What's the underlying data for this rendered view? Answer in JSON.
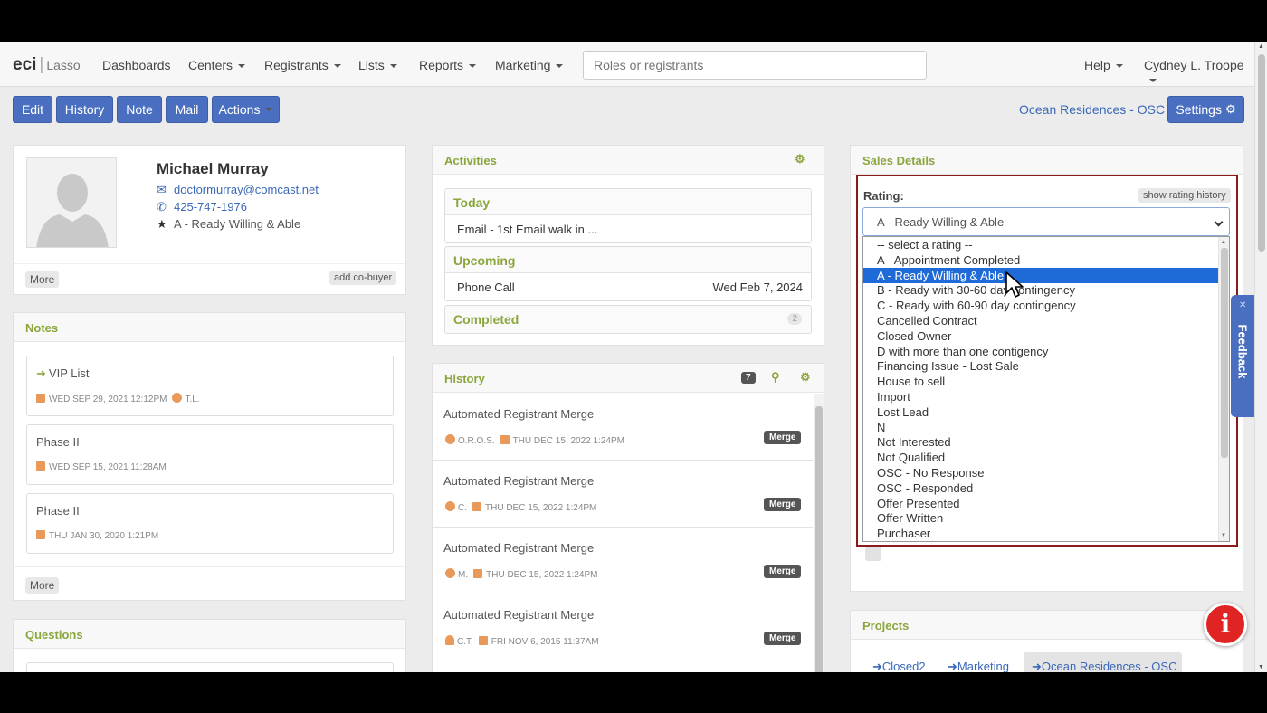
{
  "nav": {
    "logo_main": "eci",
    "logo_sub": "Lasso",
    "items": [
      "Dashboards",
      "Centers",
      "Registrants",
      "Lists",
      "Reports",
      "Marketing"
    ],
    "search_placeholder": "Roles or registrants",
    "help": "Help",
    "user": "Cydney L. Troope"
  },
  "toolbar": {
    "edit": "Edit",
    "history": "History",
    "note": "Note",
    "mail": "Mail",
    "actions": "Actions",
    "center": "Ocean Residences - OSC",
    "settings": "Settings"
  },
  "profile": {
    "name": "Michael Murray",
    "email": "doctormurray@comcast.net",
    "phone": "425-747-1976",
    "rating": "A - Ready Willing & Able",
    "more": "More",
    "add_cobuyer": "add co-buyer"
  },
  "notes": {
    "title": "Notes",
    "items": [
      {
        "title": "VIP List",
        "date": "WED SEP 29, 2021 12:12PM",
        "user": "T.L."
      },
      {
        "title": "Phase II",
        "date": "WED SEP 15, 2021 11:28AM"
      },
      {
        "title": "Phase II",
        "date": "THU JAN 30, 2020 1:21PM"
      }
    ],
    "more": "More"
  },
  "questions": {
    "title": "Questions"
  },
  "activities": {
    "title": "Activities",
    "today": "Today",
    "today_item": "Email - 1st Email walk in ...",
    "upcoming": "Upcoming",
    "upcoming_item": "Phone Call",
    "upcoming_date": "Wed Feb 7, 2024",
    "completed": "Completed",
    "completed_count": "2"
  },
  "history": {
    "title": "History",
    "count": "7",
    "items": [
      {
        "title": "Automated Registrant Merge",
        "user": "O.R.O.S.",
        "date": "THU DEC 15, 2022 1:24PM",
        "badge": "Merge"
      },
      {
        "title": "Automated Registrant Merge",
        "user": "C.",
        "date": "THU DEC 15, 2022 1:24PM",
        "badge": "Merge"
      },
      {
        "title": "Automated Registrant Merge",
        "user": "M.",
        "date": "THU DEC 15, 2022 1:24PM",
        "badge": "Merge"
      },
      {
        "title": "Automated Registrant Merge",
        "user": "C.T.",
        "date": "FRI NOV 6, 2015 11:37AM",
        "badge": "Merge"
      }
    ]
  },
  "sales": {
    "title": "Sales Details",
    "rating_label": "Rating:",
    "show_history": "show rating history",
    "selected": "A - Ready Willing & Able",
    "options": [
      "-- select a rating --",
      "A - Appointment Completed",
      "A - Ready Willing & Able",
      "B - Ready with 30-60 day contingency",
      "C - Ready with 60-90 day contingency",
      "Cancelled Contract",
      "Closed Owner",
      "D with more than one contigency",
      "Financing Issue - Lost Sale",
      "House to sell",
      "Import",
      "Lost Lead",
      "N",
      "Not Interested",
      "Not Qualified",
      "OSC - No Response",
      "OSC - Responded",
      "Offer Presented",
      "Offer Written",
      "Purchaser"
    ]
  },
  "projects": {
    "title": "Projects",
    "items": [
      "Closed2",
      "Marketing",
      "Ocean Residences - OSC"
    ]
  },
  "feedback": "Feedback",
  "info": "i",
  "colors": {
    "accent_green": "#8aa63c",
    "button_blue": "#4a6fc0",
    "selected_blue": "#1d6ad8",
    "highlight_red": "#8b1a1a"
  }
}
